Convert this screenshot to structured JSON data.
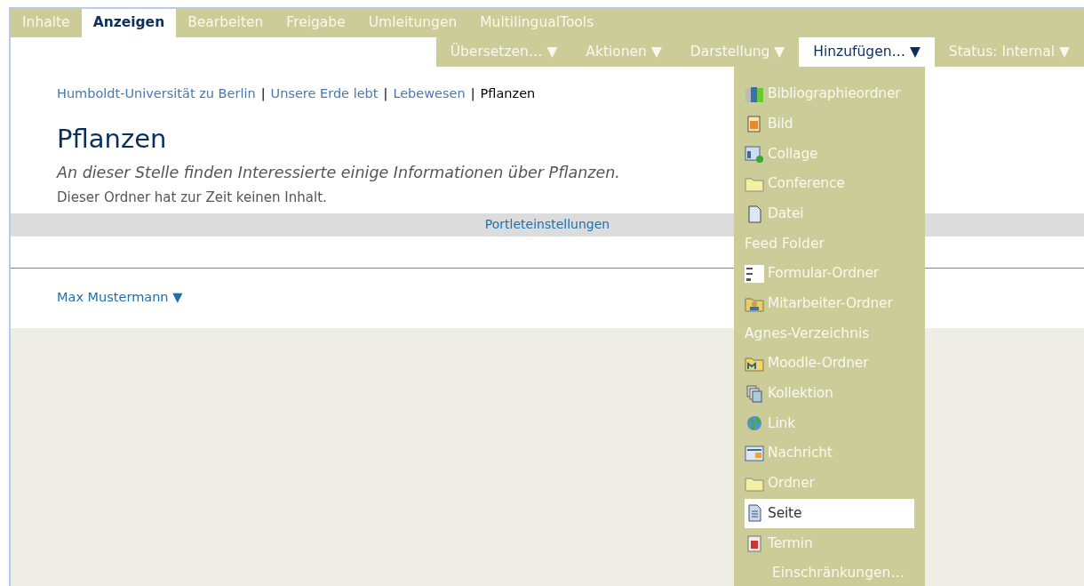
{
  "tabs": [
    {
      "label": "Inhalte",
      "selected": false
    },
    {
      "label": "Anzeigen",
      "selected": true
    },
    {
      "label": "Bearbeiten",
      "selected": false
    },
    {
      "label": "Freigabe",
      "selected": false
    },
    {
      "label": "Umleitungen",
      "selected": false
    },
    {
      "label": "MultilingualTools",
      "selected": false
    }
  ],
  "actions": [
    {
      "label": "Übersetzen…",
      "arrow": "▼",
      "selected": false
    },
    {
      "label": "Aktionen",
      "arrow": "▼",
      "selected": false
    },
    {
      "label": "Darstellung",
      "arrow": "▼",
      "selected": false
    },
    {
      "label": "Hinzufügen…",
      "arrow": "▼",
      "selected": true
    },
    {
      "label": "Status: Internal",
      "arrow": "▼",
      "selected": false
    }
  ],
  "breadcrumb": [
    {
      "label": "Humboldt-Universität zu Berlin",
      "link": true
    },
    {
      "label": "Unsere Erde lebt",
      "link": true
    },
    {
      "label": "Lebewesen",
      "link": true
    },
    {
      "label": "Pflanzen",
      "link": false
    }
  ],
  "breadcrumb_separator": "|",
  "title": "Pflanzen",
  "description": "An dieser Stelle finden Interessierte einige Informationen über Pflanzen.",
  "empty_note": "Dieser Ordner hat zur Zeit keinen Inhalt.",
  "portlet_link": "Portleteinstellungen",
  "user_menu": {
    "label": "Max Mustermann",
    "arrow": "▼"
  },
  "add_menu": [
    {
      "label": "Bibliographieordner",
      "kind": "icon",
      "selected": false
    },
    {
      "label": "Bild",
      "kind": "icon",
      "selected": false
    },
    {
      "label": "Collage",
      "kind": "icon",
      "selected": false
    },
    {
      "label": "Conference",
      "kind": "icon",
      "selected": false
    },
    {
      "label": "Datei",
      "kind": "icon",
      "selected": false
    },
    {
      "label": "Feed Folder",
      "kind": "text",
      "selected": false
    },
    {
      "label": "Formular-Ordner",
      "kind": "icon",
      "selected": false
    },
    {
      "label": "Mitarbeiter-Ordner",
      "kind": "icon",
      "selected": false
    },
    {
      "label": "Agnes-Verzeichnis",
      "kind": "text",
      "selected": false
    },
    {
      "label": "Moodle-Ordner",
      "kind": "icon",
      "selected": false
    },
    {
      "label": "Kollektion",
      "kind": "icon",
      "selected": false
    },
    {
      "label": "Link",
      "kind": "icon",
      "selected": false
    },
    {
      "label": "Nachricht",
      "kind": "icon",
      "selected": false
    },
    {
      "label": "Ordner",
      "kind": "icon",
      "selected": false
    },
    {
      "label": "Seite",
      "kind": "icon",
      "selected": true
    },
    {
      "label": "Termin",
      "kind": "icon",
      "selected": false
    },
    {
      "label": "Einschränkungen…",
      "kind": "indented",
      "selected": false
    }
  ]
}
